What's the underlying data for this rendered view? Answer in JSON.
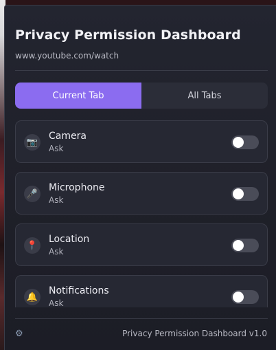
{
  "header": {
    "title": "Privacy Permission Dashboard",
    "url": "www.youtube.com/watch"
  },
  "tabs": [
    {
      "label": "Current Tab",
      "active": true
    },
    {
      "label": "All Tabs",
      "active": false
    }
  ],
  "permissions": [
    {
      "name": "Camera",
      "state": "Ask",
      "icon": "camera-icon",
      "glyph": "📷",
      "enabled": false
    },
    {
      "name": "Microphone",
      "state": "Ask",
      "icon": "microphone-icon",
      "glyph": "🎤",
      "enabled": false
    },
    {
      "name": "Location",
      "state": "Ask",
      "icon": "location-pin-icon",
      "glyph": "📍",
      "enabled": false
    },
    {
      "name": "Notifications",
      "state": "Ask",
      "icon": "bell-icon",
      "glyph": "🔔",
      "enabled": false
    }
  ],
  "footer": {
    "settings_icon": "gear-icon",
    "version": "Privacy Permission Dashboard v1.0"
  },
  "colors": {
    "accent": "#8b6cf0",
    "panel": "#1f2029",
    "card": "#262833"
  }
}
